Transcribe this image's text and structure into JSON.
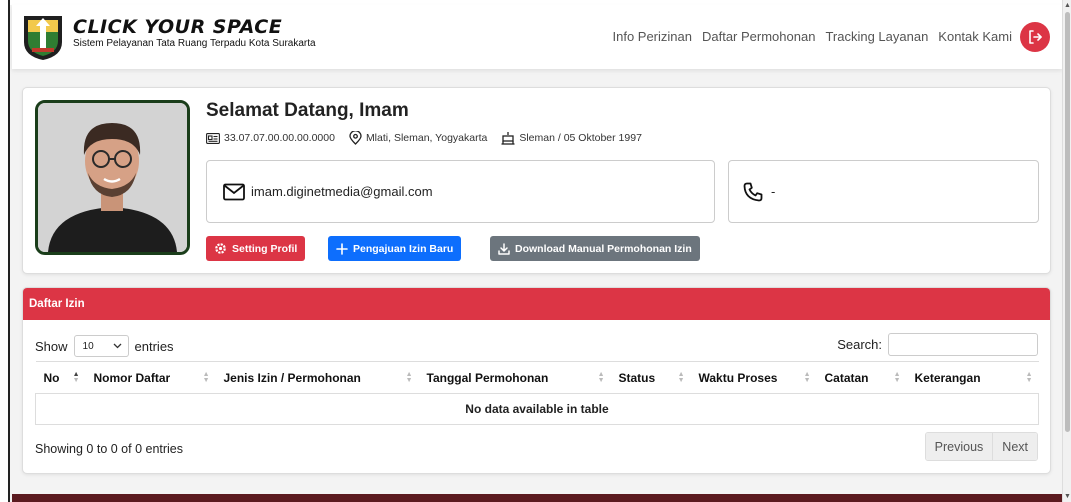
{
  "brand": {
    "title": "CLICK YOUR SPACE",
    "subtitle": "Sistem Pelayanan Tata Ruang Terpadu Kota Surakarta"
  },
  "nav": {
    "items": [
      "Info Perizinan",
      "Daftar Permohonan",
      "Tracking Layanan",
      "Kontak Kami"
    ],
    "logout_icon": "logout-icon"
  },
  "profile": {
    "welcome": "Selamat Datang, Imam",
    "id_number": "33.07.07.00.00.00.0000",
    "address": "Mlati, Sleman, Yogyakarta",
    "birth": "Sleman / 05 Oktober 1997",
    "email": "imam.diginetmedia@gmail.com",
    "phone": "-"
  },
  "actions": {
    "setting": "Setting Profil",
    "new_request": "Pengajuan Izin Baru",
    "download": "Download Manual Permohonan Izin"
  },
  "list": {
    "header": "Daftar Izin",
    "show_label": "Show",
    "entries_label": "entries",
    "length_value": "10",
    "search_label": "Search:",
    "columns": [
      "No",
      "Nomor Daftar",
      "Jenis Izin / Permohonan",
      "Tanggal Permohonan",
      "Status",
      "Waktu Proses",
      "Catatan",
      "Keterangan"
    ],
    "empty": "No data available in table",
    "info": "Showing 0 to 0 of 0 entries",
    "prev": "Previous",
    "next": "Next"
  },
  "colors": {
    "primary_red": "#dc3545",
    "primary_blue": "#0d6efd",
    "secondary_gray": "#6c757d"
  }
}
